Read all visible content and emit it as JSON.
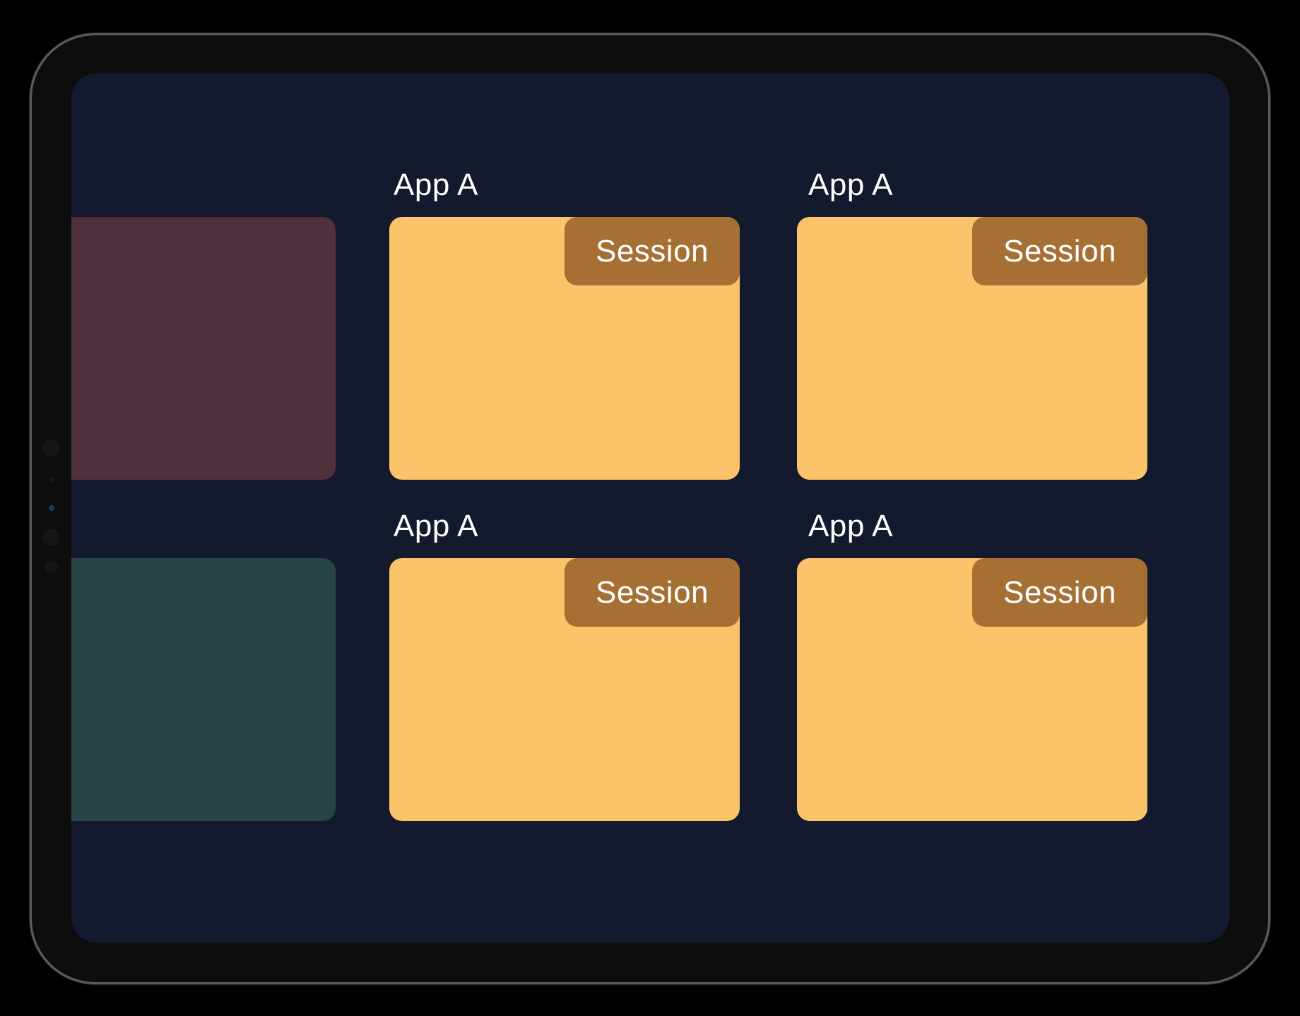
{
  "colors": {
    "screen_background": "#141a2d",
    "card_fill": "#fbc46a",
    "session_tab_fill": "#a67034",
    "side_card_top": "#502f3e",
    "side_card_bottom": "#274445",
    "label_text": "#ffffff"
  },
  "side_cards": [
    {
      "name": "side-card-maroon"
    },
    {
      "name": "side-card-teal"
    }
  ],
  "app_cards": [
    {
      "label": "App A",
      "session_label": "Session"
    },
    {
      "label": "App A",
      "session_label": "Session"
    },
    {
      "label": "App A",
      "session_label": "Session"
    },
    {
      "label": "App A",
      "session_label": "Session"
    }
  ]
}
